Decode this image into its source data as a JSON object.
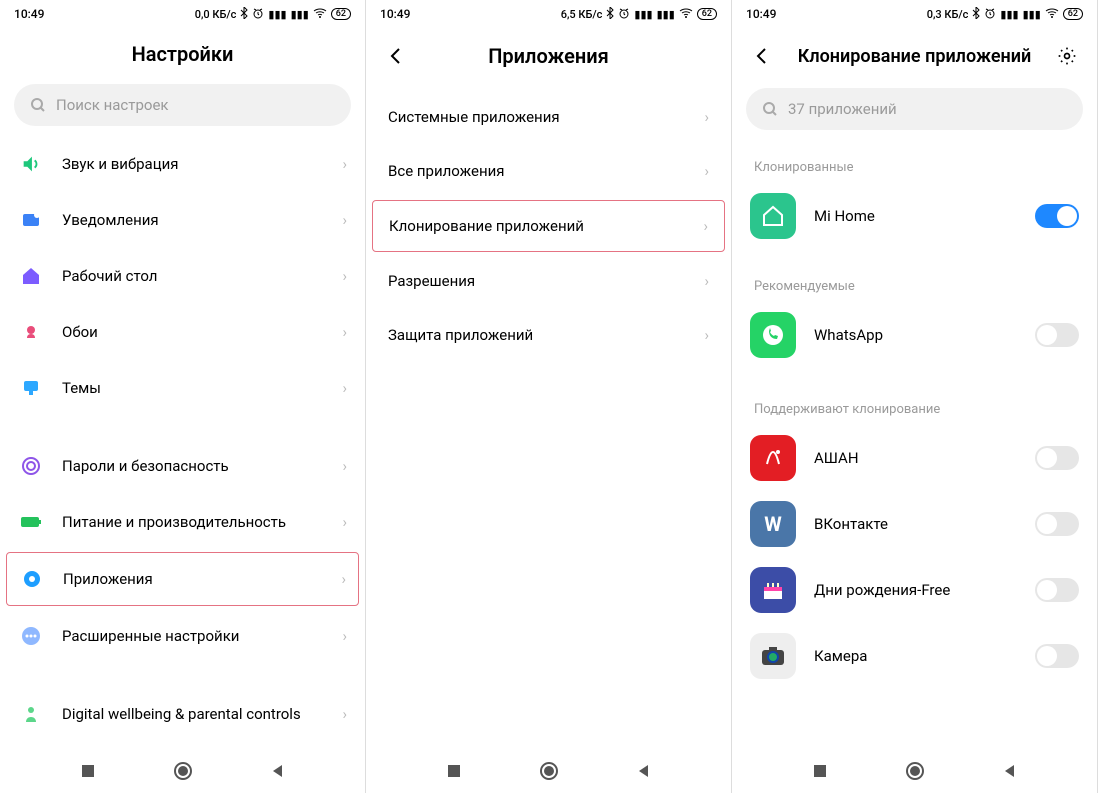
{
  "screens": [
    {
      "time": "10:49",
      "net": "0,0 КБ/с",
      "title": "Настройки",
      "search_placeholder": "Поиск настроек",
      "items": [
        {
          "label": "Звук и вибрация"
        },
        {
          "label": "Уведомления"
        },
        {
          "label": "Рабочий стол"
        },
        {
          "label": "Обои"
        },
        {
          "label": "Темы"
        },
        {
          "label": "Пароли и безопасность"
        },
        {
          "label": "Питание и производительность"
        },
        {
          "label": "Приложения",
          "highlight": true
        },
        {
          "label": "Расширенные настройки"
        },
        {
          "label": "Digital wellbeing & parental controls"
        }
      ]
    },
    {
      "time": "10:49",
      "net": "6,5 КБ/с",
      "title": "Приложения",
      "items": [
        {
          "label": "Системные приложения"
        },
        {
          "label": "Все приложения"
        },
        {
          "label": "Клонирование приложений",
          "highlight": true
        },
        {
          "label": "Разрешения"
        },
        {
          "label": "Защита приложений"
        }
      ]
    },
    {
      "time": "10:49",
      "net": "0,3 КБ/с",
      "title": "Клонирование приложений",
      "search_placeholder": "37 приложений",
      "sections": {
        "cloned": "Клонированные",
        "recommended": "Рекомендуемые",
        "supported": "Поддерживают клонирование"
      },
      "apps": {
        "mihome": "Mi Home",
        "whatsapp": "WhatsApp",
        "ashan": "АШАН",
        "vk": "ВКонтакте",
        "bday": "Дни рождения-Free",
        "camera": "Камера"
      }
    }
  ],
  "battery": "62"
}
